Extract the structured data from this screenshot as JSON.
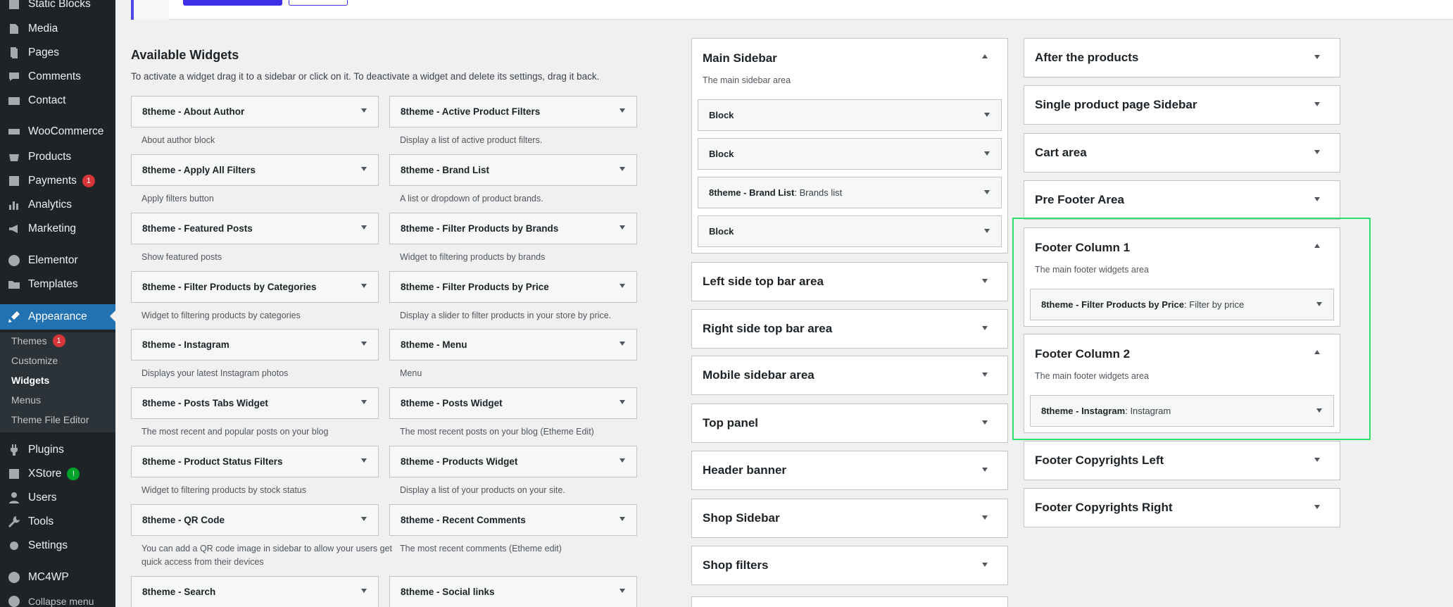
{
  "admin_menu": {
    "items": [
      {
        "label": "Static Blocks",
        "icon": "table-icon"
      },
      {
        "label": "Media",
        "icon": "media-icon"
      },
      {
        "label": "Pages",
        "icon": "pages-icon"
      },
      {
        "label": "Comments",
        "icon": "comments-icon"
      },
      {
        "label": "Contact",
        "icon": "mail-icon"
      },
      {
        "label": "WooCommerce",
        "icon": "woocommerce-icon"
      },
      {
        "label": "Products",
        "icon": "products-icon"
      },
      {
        "label": "Payments",
        "icon": "payments-icon",
        "badge": "1"
      },
      {
        "label": "Analytics",
        "icon": "analytics-icon"
      },
      {
        "label": "Marketing",
        "icon": "megaphone-icon"
      },
      {
        "label": "Elementor",
        "icon": "elementor-icon"
      },
      {
        "label": "Templates",
        "icon": "folder-icon"
      },
      {
        "label": "Appearance",
        "icon": "brush-icon"
      },
      {
        "label": "Plugins",
        "icon": "plugins-icon"
      },
      {
        "label": "XStore",
        "icon": "xstore-icon",
        "badge": "!"
      },
      {
        "label": "Users",
        "icon": "users-icon"
      },
      {
        "label": "Tools",
        "icon": "tools-icon"
      },
      {
        "label": "Settings",
        "icon": "settings-icon"
      },
      {
        "label": "MC4WP",
        "icon": "mc4wp-icon"
      },
      {
        "label": "Collapse menu",
        "icon": "collapse-icon"
      }
    ],
    "appearance_sub": [
      {
        "label": "Themes",
        "badge": "1"
      },
      {
        "label": "Customize"
      },
      {
        "label": "Widgets"
      },
      {
        "label": "Menus"
      },
      {
        "label": "Theme File Editor"
      }
    ]
  },
  "available": {
    "title": "Available Widgets",
    "description": "To activate a widget drag it to a sidebar or click on it. To deactivate a widget and delete its settings, drag it back.",
    "widgets": [
      {
        "name": "8theme - About Author",
        "desc": "About author block"
      },
      {
        "name": "8theme - Active Product Filters",
        "desc": "Display a list of active product filters."
      },
      {
        "name": "8theme - Apply All Filters",
        "desc": "Apply filters button"
      },
      {
        "name": "8theme - Brand List",
        "desc": "A list or dropdown of product brands."
      },
      {
        "name": "8theme - Featured Posts",
        "desc": "Show featured posts"
      },
      {
        "name": "8theme - Filter Products by Brands",
        "desc": "Widget to filtering products by brands"
      },
      {
        "name": "8theme - Filter Products by Categories",
        "desc": "Widget to filtering products by categories"
      },
      {
        "name": "8theme - Filter Products by Price",
        "desc": "Display a slider to filter products in your store by price."
      },
      {
        "name": "8theme - Instagram",
        "desc": "Displays your latest Instagram photos"
      },
      {
        "name": "8theme - Menu",
        "desc": "Menu"
      },
      {
        "name": "8theme - Posts Tabs Widget",
        "desc": "The most recent and popular posts on your blog"
      },
      {
        "name": "8theme - Posts Widget",
        "desc": "The most recent posts on your blog (Etheme Edit)"
      },
      {
        "name": "8theme - Product Status Filters",
        "desc": "Widget to filtering products by stock status"
      },
      {
        "name": "8theme - Products Widget",
        "desc": "Display a list of your products on your site."
      },
      {
        "name": "8theme - QR Code",
        "desc": "You can add a QR code image in sidebar to allow your users get quick access from their devices"
      },
      {
        "name": "8theme - Recent Comments",
        "desc": "The most recent comments (Etheme edit)"
      },
      {
        "name": "8theme - Search",
        "desc": ""
      },
      {
        "name": "8theme - Social links",
        "desc": ""
      }
    ]
  },
  "main_sidebar": {
    "title": "Main Sidebar",
    "description": "The main sidebar area",
    "widgets": [
      {
        "name": "Block",
        "sub": ""
      },
      {
        "name": "Block",
        "sub": ""
      },
      {
        "name": "8theme - Brand List",
        "sub": "Brands list"
      },
      {
        "name": "Block",
        "sub": ""
      }
    ]
  },
  "middle_sidebars": [
    "Left side top bar area",
    "Right side top bar area",
    "Mobile sidebar area",
    "Top panel",
    "Header banner",
    "Shop Sidebar",
    "Shop filters"
  ],
  "right_sidebars": [
    "After the products",
    "Single product page Sidebar",
    "Cart area",
    "Pre Footer Area"
  ],
  "footer_col1": {
    "title": "Footer Column 1",
    "description": "The main footer widgets area",
    "widget": "8theme - Filter Products by Price",
    "sub": "Filter by price"
  },
  "footer_col2": {
    "title": "Footer Column 2",
    "description": "The main footer widgets area",
    "widget": "8theme - Instagram",
    "sub": "Instagram"
  },
  "bottom_right_sidebars": [
    "Footer Copyrights Left",
    "Footer Copyrights Right"
  ],
  "colors": {
    "accent": "#2271b1",
    "highlight": "#2ee06a",
    "admin_bg": "#1d2327"
  }
}
